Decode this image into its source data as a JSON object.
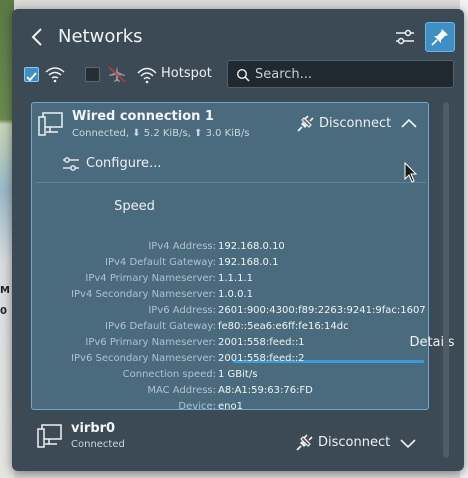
{
  "header": {
    "title": "Networks",
    "back_icon": "back-arrow-icon",
    "configure_icon": "sliders-icon",
    "pin_icon": "pin-icon"
  },
  "toolbar": {
    "wifi_enabled": true,
    "airplane_mode": false,
    "hotspot_label": "Hotspot",
    "search_placeholder": "Search..."
  },
  "connections": [
    {
      "name": "Wired connection 1",
      "status_prefix": "Connected, ",
      "download": "5.2 KiB/s",
      "upload": "3.0 KiB/s",
      "action": "Disconnect",
      "expanded": true,
      "configure_label": "Configure...",
      "tabs": [
        "Speed",
        "Details"
      ],
      "active_tab": "Details",
      "details": [
        {
          "key": "IPv4 Address:",
          "value": "192.168.0.10"
        },
        {
          "key": "IPv4 Default Gateway:",
          "value": "192.168.0.1"
        },
        {
          "key": "IPv4 Primary Nameserver:",
          "value": "1.1.1.1"
        },
        {
          "key": "IPv4 Secondary Nameserver:",
          "value": "1.0.0.1"
        },
        {
          "key": "IPv6 Address:",
          "value": "2601:900:4300:f89:2263:9241:9fac:1607"
        },
        {
          "key": "IPv6 Default Gateway:",
          "value": "fe80::5ea6:e6ff:fe16:14dc"
        },
        {
          "key": "IPv6 Primary Nameserver:",
          "value": "2001:558:feed::1"
        },
        {
          "key": "IPv6 Secondary Nameserver:",
          "value": "2001:558:feed::2"
        },
        {
          "key": "Connection speed:",
          "value": "1 GBit/s"
        },
        {
          "key": "MAC Address:",
          "value": "A8:A1:59:63:76:FD"
        },
        {
          "key": "Device:",
          "value": "eno1"
        }
      ]
    },
    {
      "name": "virbr0",
      "status": "Connected",
      "action": "Disconnect",
      "expanded": false
    }
  ],
  "desktop_edge": {
    "left_letter_1": "M",
    "left_letter_2": "0"
  },
  "colors": {
    "popup_bg": "#3c4a55",
    "card_bg": "#4a6b7d",
    "accent": "#3d9ad9"
  }
}
